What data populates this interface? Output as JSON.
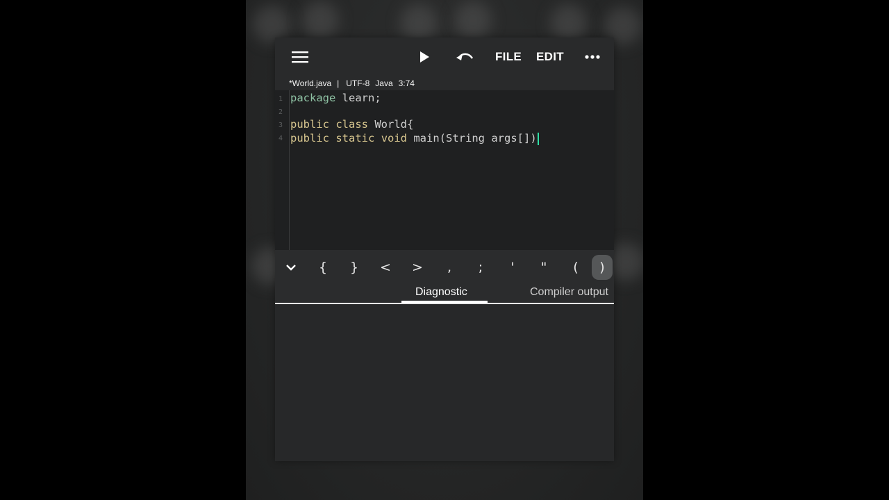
{
  "toolbar": {
    "file_label": "FILE",
    "edit_label": "EDIT",
    "icons": {
      "menu": "hamburger-menu-icon",
      "run": "play-icon",
      "undo": "undo-icon",
      "more": "more-horizontal-icon"
    }
  },
  "status": {
    "filename": "*World.java",
    "separator": "|",
    "encoding": "UTF-8",
    "language": "Java",
    "cursor": "3:74"
  },
  "editor": {
    "line_numbers": [
      "1",
      "2",
      "3",
      "4"
    ],
    "lines": [
      {
        "tokens": [
          {
            "t": "package",
            "c": "pkg"
          },
          {
            "t": " learn;",
            "c": "plain"
          }
        ]
      },
      {
        "tokens": []
      },
      {
        "tokens": [
          {
            "t": "public",
            "c": "kw"
          },
          {
            "t": " ",
            "c": "plain"
          },
          {
            "t": "class",
            "c": "kw"
          },
          {
            "t": " World{",
            "c": "plain"
          }
        ]
      },
      {
        "tokens": [
          {
            "t": "public",
            "c": "kw"
          },
          {
            "t": " ",
            "c": "plain"
          },
          {
            "t": "static",
            "c": "kw"
          },
          {
            "t": " ",
            "c": "plain"
          },
          {
            "t": "void",
            "c": "kw"
          },
          {
            "t": " main(String args[])",
            "c": "plain"
          }
        ]
      }
    ],
    "colors": {
      "keyword": "#d7c68f",
      "package_keyword": "#8fc2a4",
      "text": "#d0d0d0",
      "caret": "#2fe0a6"
    }
  },
  "symbol_bar": {
    "collapse_icon": "chevron-down-icon",
    "symbols": [
      "{",
      "}",
      "<",
      ">",
      ",",
      ";",
      "'",
      "\"",
      "(",
      ")"
    ],
    "pressed_symbol": ")"
  },
  "tabs": {
    "items": [
      "Diagnostic",
      "Compiler output"
    ],
    "active": "Diagnostic"
  }
}
